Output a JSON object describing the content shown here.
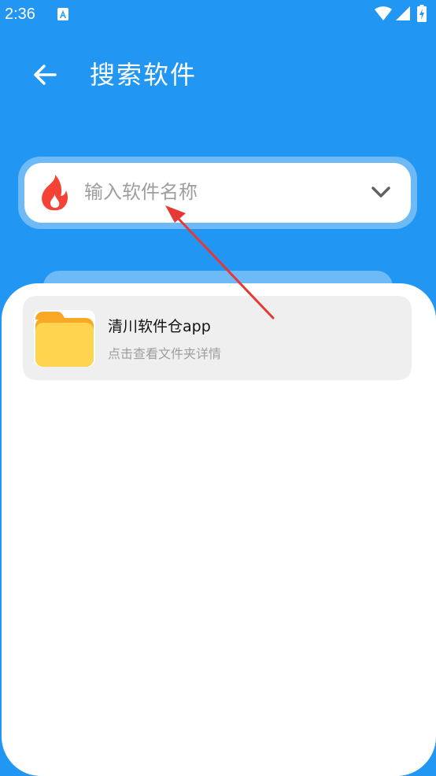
{
  "status_bar": {
    "time": "2:36",
    "notification_icon": "a-app-icon",
    "wifi_icon": "wifi-icon",
    "signal_icon": "signal-icon",
    "battery_icon": "battery-charging-icon"
  },
  "header": {
    "back_icon": "arrow-left-icon",
    "title": "搜索软件"
  },
  "search": {
    "leading_icon": "flame-icon",
    "placeholder": "输入软件名称",
    "value": "",
    "trailing_icon": "chevron-down-icon"
  },
  "results": [
    {
      "icon": "folder-icon",
      "title": "清川软件仓app",
      "subtitle": "点击查看文件夹详情"
    }
  ],
  "colors": {
    "primary": "#2196F3",
    "background": "#ffffff",
    "card": "#efefef",
    "flame": "#F44336",
    "folder": "#FFD54F",
    "folder_tab": "#F9A825",
    "annotation_arrow": "#E53935"
  }
}
